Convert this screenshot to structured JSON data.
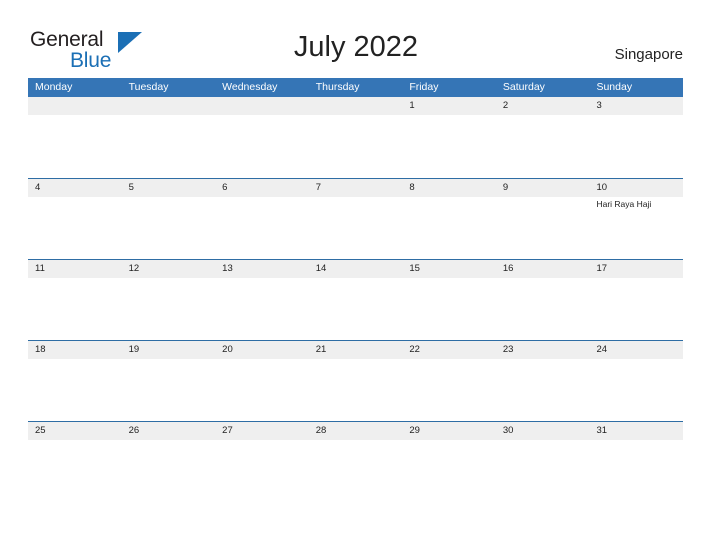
{
  "brand": {
    "name_part1": "General",
    "name_part2": "Blue",
    "triangle_color": "#1b6fb5"
  },
  "header": {
    "title": "July 2022",
    "region": "Singapore"
  },
  "theme": {
    "header_blue": "#3575b6",
    "row_line_blue": "#2e6da4",
    "date_band_gray": "#efefef",
    "text_dark": "#222222"
  },
  "calendar": {
    "weekdays": [
      "Monday",
      "Tuesday",
      "Wednesday",
      "Thursday",
      "Friday",
      "Saturday",
      "Sunday"
    ],
    "weeks": [
      [
        {
          "day": "",
          "event": ""
        },
        {
          "day": "",
          "event": ""
        },
        {
          "day": "",
          "event": ""
        },
        {
          "day": "",
          "event": ""
        },
        {
          "day": "1",
          "event": ""
        },
        {
          "day": "2",
          "event": ""
        },
        {
          "day": "3",
          "event": ""
        }
      ],
      [
        {
          "day": "4",
          "event": ""
        },
        {
          "day": "5",
          "event": ""
        },
        {
          "day": "6",
          "event": ""
        },
        {
          "day": "7",
          "event": ""
        },
        {
          "day": "8",
          "event": ""
        },
        {
          "day": "9",
          "event": ""
        },
        {
          "day": "10",
          "event": "Hari Raya Haji"
        }
      ],
      [
        {
          "day": "11",
          "event": ""
        },
        {
          "day": "12",
          "event": ""
        },
        {
          "day": "13",
          "event": ""
        },
        {
          "day": "14",
          "event": ""
        },
        {
          "day": "15",
          "event": ""
        },
        {
          "day": "16",
          "event": ""
        },
        {
          "day": "17",
          "event": ""
        }
      ],
      [
        {
          "day": "18",
          "event": ""
        },
        {
          "day": "19",
          "event": ""
        },
        {
          "day": "20",
          "event": ""
        },
        {
          "day": "21",
          "event": ""
        },
        {
          "day": "22",
          "event": ""
        },
        {
          "day": "23",
          "event": ""
        },
        {
          "day": "24",
          "event": ""
        }
      ],
      [
        {
          "day": "25",
          "event": ""
        },
        {
          "day": "26",
          "event": ""
        },
        {
          "day": "27",
          "event": ""
        },
        {
          "day": "28",
          "event": ""
        },
        {
          "day": "29",
          "event": ""
        },
        {
          "day": "30",
          "event": ""
        },
        {
          "day": "31",
          "event": ""
        }
      ]
    ]
  }
}
